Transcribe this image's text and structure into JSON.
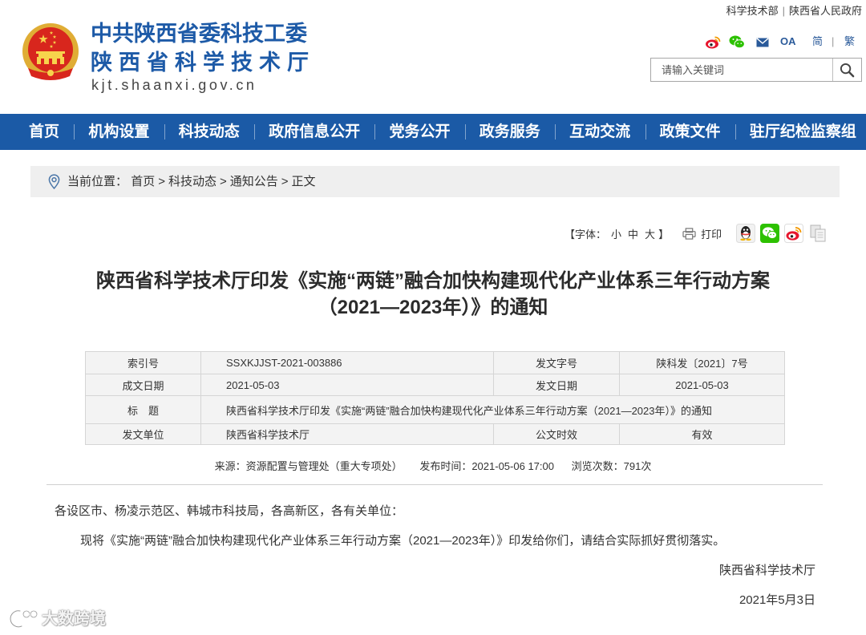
{
  "header": {
    "org_name_line1": "中共陕西省委科技工委",
    "org_name_line2": "陕西省科学技术厅",
    "domain": "kjt.shaanxi.gov.cn",
    "top_links": [
      "科学技术部",
      "陕西省人民政府"
    ],
    "top_links_separator": "|",
    "oa_label": "OA",
    "lang": {
      "simplified": "简",
      "separator": "|",
      "traditional": "繁"
    },
    "search": {
      "placeholder": "请输入关键词"
    }
  },
  "nav": {
    "items": [
      "首页",
      "机构设置",
      "科技动态",
      "政府信息公开",
      "党务公开",
      "政务服务",
      "互动交流",
      "政策文件",
      "驻厅纪检监察组"
    ]
  },
  "breadcrumb": {
    "prefix": "当前位置：",
    "items": [
      "首页",
      "科技动态",
      "通知公告",
      "正文"
    ],
    "separator": ">"
  },
  "toolbar": {
    "font_prefix": "【字体：",
    "font_sizes": [
      "小",
      "中",
      "大"
    ],
    "font_suffix": "】",
    "print_label": "打印"
  },
  "article": {
    "title_lines": [
      "陕西省科学技术厅印发《实施“两链”融合加快构建现代化产业体系三年行动方案",
      "（2021—2023年）》的通知"
    ],
    "meta": {
      "index_label": "索引号",
      "index_value": "SSXKJJST-2021-003886",
      "doc_no_label": "发文字号",
      "doc_no_value": "陕科发〔2021〕7号",
      "written_date_label": "成文日期",
      "written_date_value": "2021-05-03",
      "issue_date_label": "发文日期",
      "issue_date_value": "2021-05-03",
      "title_label": "标　题",
      "title_value": "陕西省科学技术厅印发《实施“两链”融合加快构建现代化产业体系三年行动方案（2021—2023年）》的通知",
      "issuer_label": "发文单位",
      "issuer_value": "陕西省科学技术厅",
      "validity_label": "公文时效",
      "validity_value": "有效"
    },
    "info": {
      "source_label": "来源：",
      "source_value": "资源配置与管理处（重大专项处）",
      "time_label": "发布时间：",
      "time_value": "2021-05-06 17:00",
      "views_label": "浏览次数：",
      "views_value": "791次"
    },
    "body": {
      "salutation": "各设区市、杨凌示范区、韩城市科技局，各高新区，各有关单位：",
      "paragraph": "现将《实施“两链”融合加快构建现代化产业体系三年行动方案（2021—2023年）》印发给你们，请结合实际抓好贯彻落实。",
      "signature": "陕西省科学技术厅",
      "date": "2021年5月3日"
    }
  },
  "watermark": {
    "text": "大数跨境"
  },
  "icons": [
    "national-emblem-icon",
    "weibo-icon",
    "wechat-icon",
    "mail-icon",
    "search-icon",
    "location-pin-icon",
    "printer-icon",
    "qq-share-icon",
    "wechat-share-icon",
    "weibo-share-icon",
    "copy-link-icon",
    "watermark-logo-icon"
  ],
  "colors": {
    "brand_blue": "#1d5aa7",
    "nav_background": "#1b5aa6",
    "link_blue": "#2a5a9a",
    "breadcrumb_background": "#efefef",
    "table_background": "#f3f3f3",
    "weibo_red": "#e6162d",
    "wechat_green": "#2dc100"
  }
}
